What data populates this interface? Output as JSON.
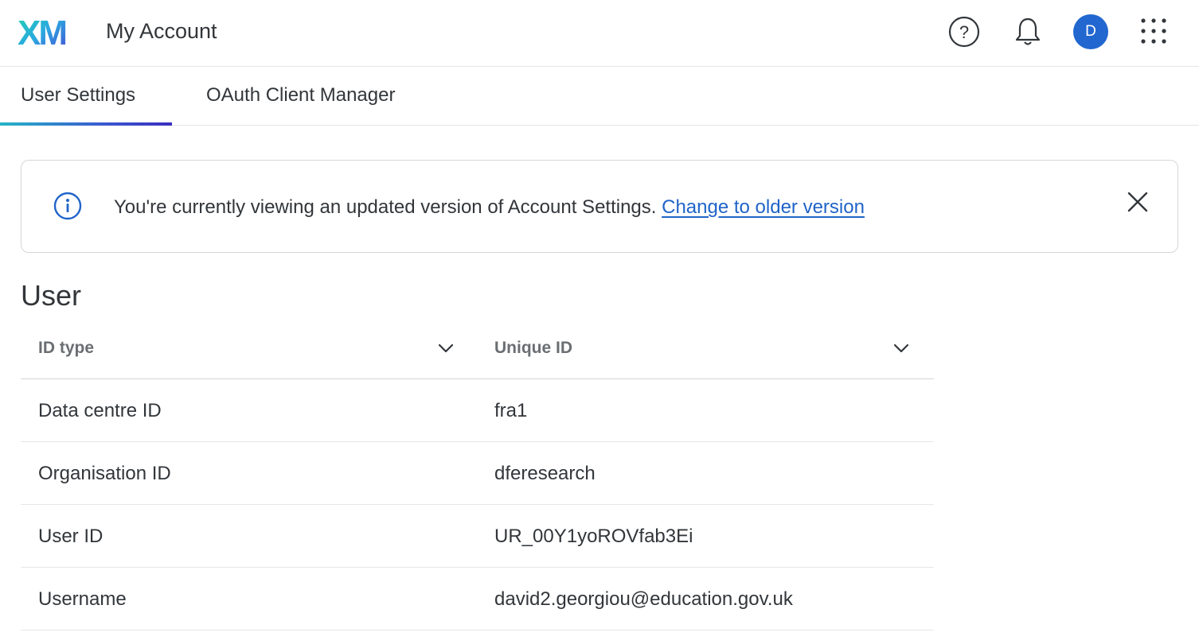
{
  "header": {
    "logo_text": "XM",
    "title": "My Account",
    "help_icon": "help-circle-icon",
    "bell_icon": "bell-icon",
    "avatar_initial": "D",
    "apps_icon": "grid-apps-icon",
    "avatar_color": "#2267d0"
  },
  "tabs": [
    {
      "label": "User Settings",
      "active": true
    },
    {
      "label": "OAuth Client Manager",
      "active": false
    }
  ],
  "banner": {
    "icon": "info-icon",
    "text": "You're currently viewing an updated version of Account Settings. ",
    "link": "Change to older version",
    "close_icon": "close-icon",
    "link_color": "#2064c8"
  },
  "section": {
    "title": "User"
  },
  "table": {
    "columns": [
      "ID type",
      "Unique ID"
    ],
    "rows": [
      [
        "Data centre ID",
        "fra1"
      ],
      [
        "Organisation ID",
        "dferesearch"
      ],
      [
        "User ID",
        "UR_00Y1yoROVfab3Ei"
      ],
      [
        "Username",
        "david2.georgiou@education.gov.uk"
      ]
    ]
  }
}
